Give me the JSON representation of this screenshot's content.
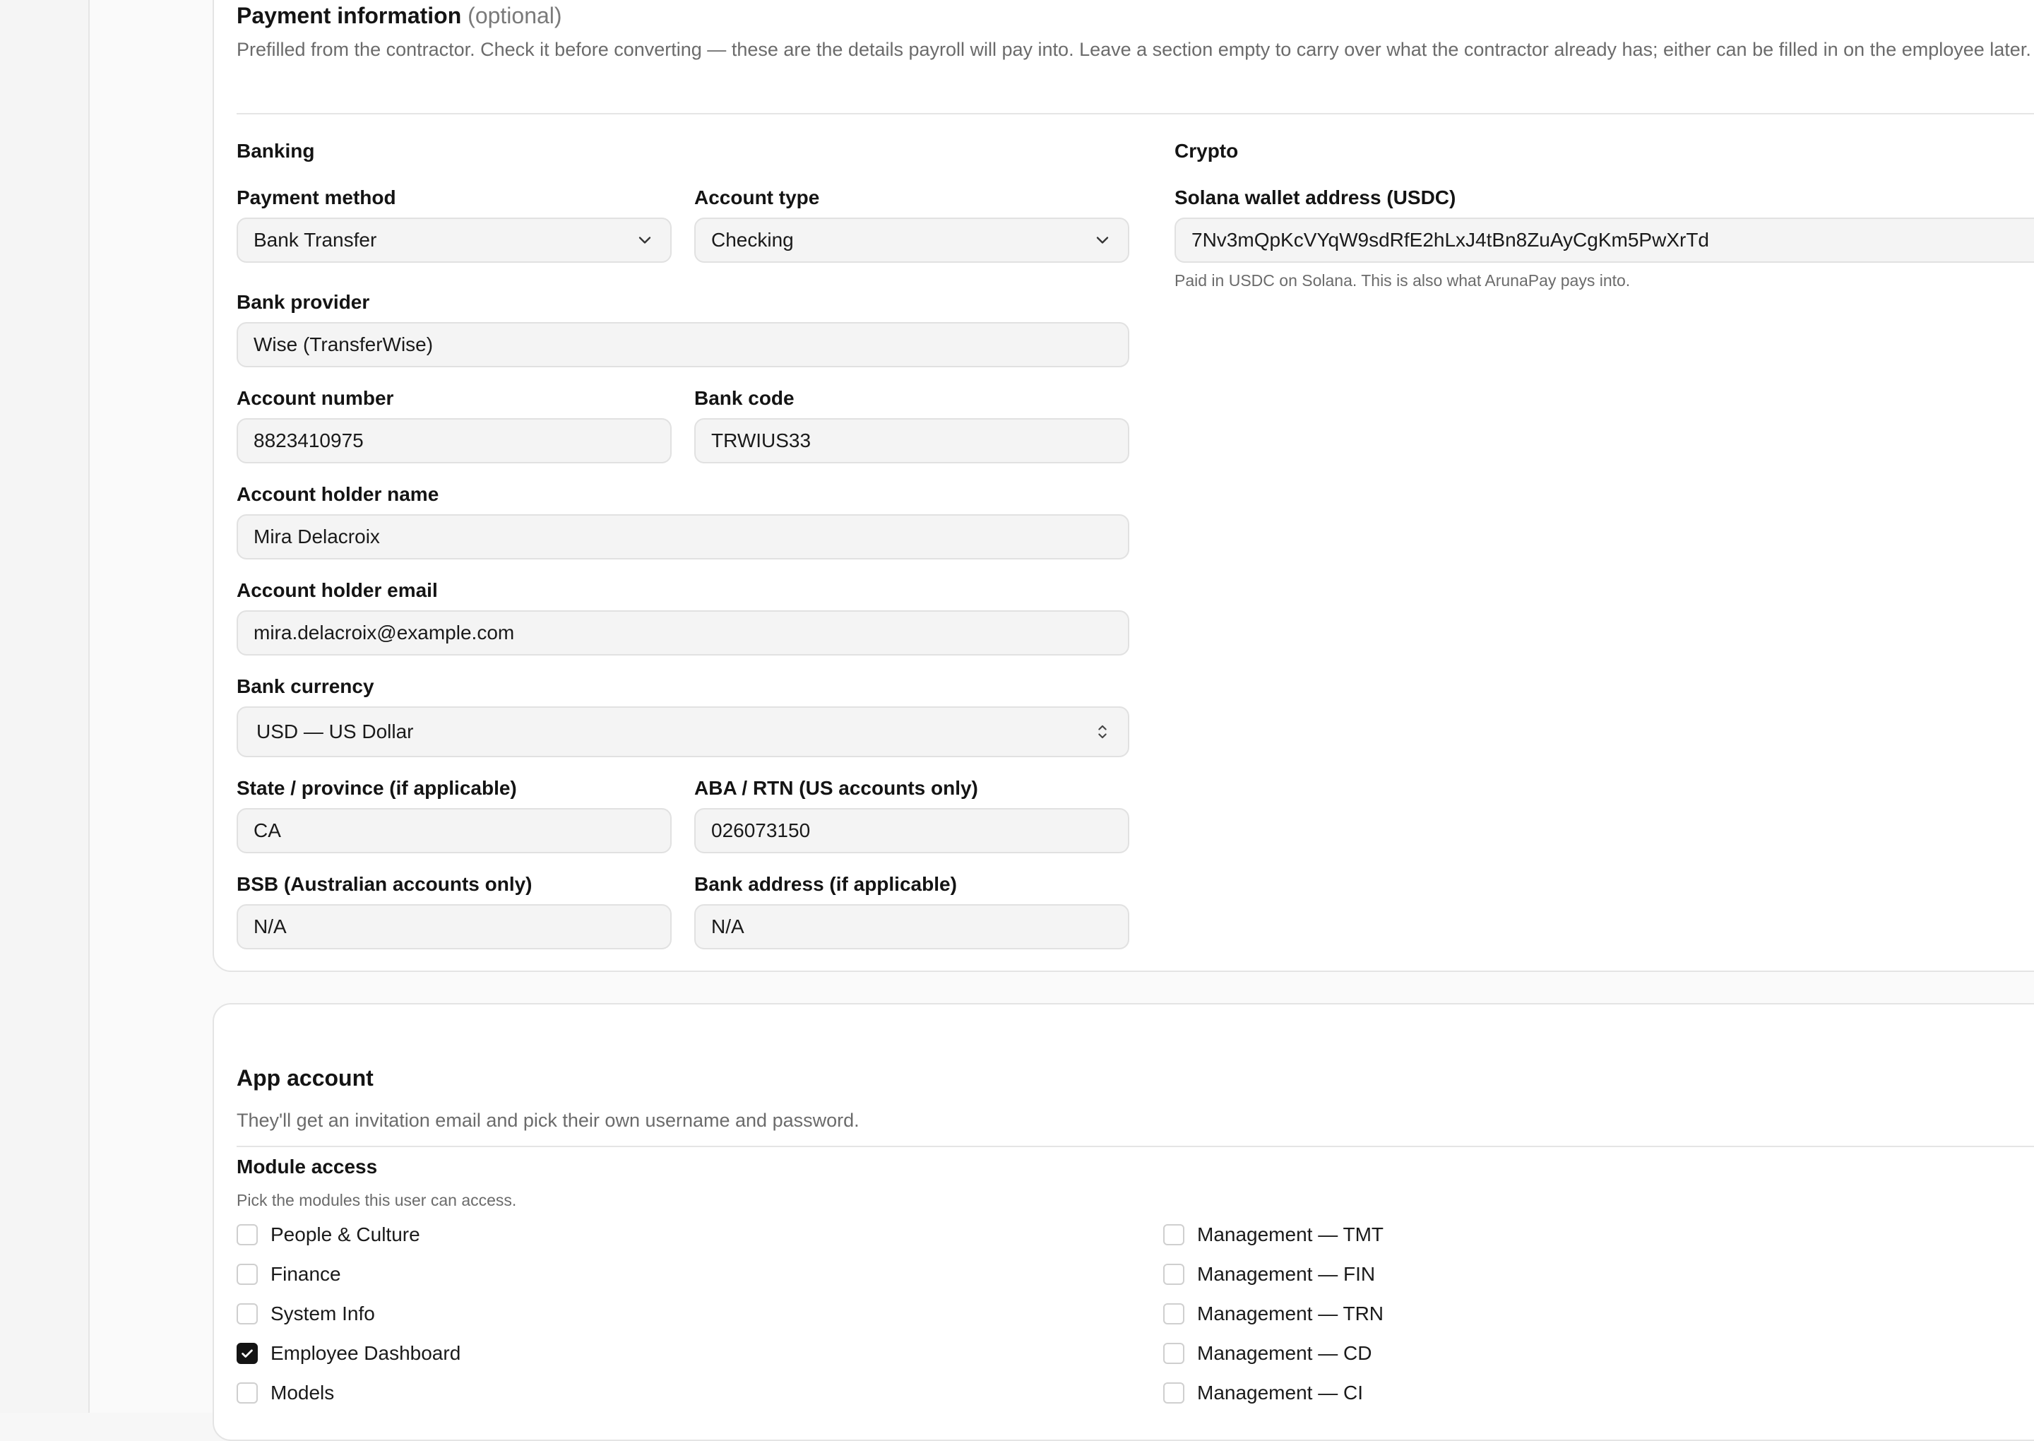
{
  "payment": {
    "title": "Payment information",
    "optional": "(optional)",
    "description": "Prefilled from the contractor. Check it before converting — these are the details payroll will pay into. Leave a section empty to carry over what the contractor already has; either can be filled in on the employee later.",
    "banking": {
      "heading": "Banking",
      "payment_method": {
        "label": "Payment method",
        "value": "Bank Transfer"
      },
      "account_type": {
        "label": "Account type",
        "value": "Checking"
      },
      "bank_provider": {
        "label": "Bank provider",
        "value": "Wise (TransferWise)"
      },
      "account_number": {
        "label": "Account number",
        "value": "8823410975"
      },
      "bank_code": {
        "label": "Bank code",
        "value": "TRWIUS33"
      },
      "holder_name": {
        "label": "Account holder name",
        "value": "Mira Delacroix"
      },
      "holder_email": {
        "label": "Account holder email",
        "value": "mira.delacroix@example.com"
      },
      "currency": {
        "label": "Bank currency",
        "value": "USD — US Dollar"
      },
      "state": {
        "label": "State / province (if applicable)",
        "value": "CA"
      },
      "aba": {
        "label": "ABA / RTN (US accounts only)",
        "value": "026073150"
      },
      "bsb": {
        "label": "BSB (Australian accounts only)",
        "value": "N/A"
      },
      "bank_address": {
        "label": "Bank address (if applicable)",
        "value": "N/A"
      }
    },
    "crypto": {
      "heading": "Crypto",
      "wallet": {
        "label": "Solana wallet address (USDC)",
        "value": "7Nv3mQpKcVYqW9sdRfE2hLxJ4tBn8ZuAyCgKm5PwXrTd"
      },
      "hint": "Paid in USDC on Solana. This is also what ArunaPay pays into."
    }
  },
  "app_account": {
    "title": "App account",
    "description": "They'll get an invitation email and pick their own username and password.",
    "module_access": {
      "label": "Module access",
      "hint": "Pick the modules this user can access.",
      "left": [
        {
          "label": "People & Culture",
          "checked": false
        },
        {
          "label": "Finance",
          "checked": false
        },
        {
          "label": "System Info",
          "checked": false
        },
        {
          "label": "Employee Dashboard",
          "checked": true
        },
        {
          "label": "Models",
          "checked": false
        }
      ],
      "right": [
        {
          "label": "Management — TMT",
          "checked": false
        },
        {
          "label": "Management — FIN",
          "checked": false
        },
        {
          "label": "Management — TRN",
          "checked": false
        },
        {
          "label": "Management — CD",
          "checked": false
        },
        {
          "label": "Management — CI",
          "checked": false
        }
      ]
    }
  },
  "icons": {
    "select": "chevron-down-icon",
    "currency_select": "chevron-up-down-icon",
    "checkbox_on": "check-icon"
  }
}
